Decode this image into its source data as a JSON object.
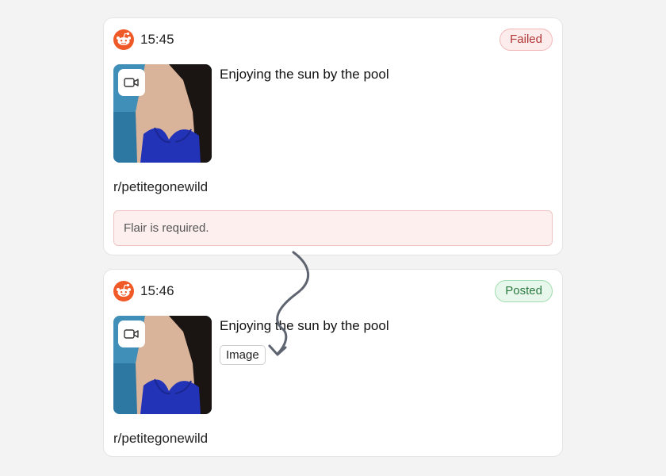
{
  "posts": [
    {
      "platform_icon": "reddit-icon",
      "time": "15:45",
      "status": "Failed",
      "media_icon": "video-camera-icon",
      "title": "Enjoying the sun by the pool",
      "subreddit": "r/petitegonewild",
      "error": "Flair is required."
    },
    {
      "platform_icon": "reddit-icon",
      "time": "15:46",
      "status": "Posted",
      "media_icon": "video-camera-icon",
      "title": "Enjoying the sun by the pool",
      "flair": "Image",
      "subreddit": "r/petitegonewild"
    }
  ],
  "colors": {
    "page_background": "#f3f3f3",
    "reddit_orange": "#f05a28",
    "failed": "#b13636",
    "posted": "#2a7a40"
  }
}
